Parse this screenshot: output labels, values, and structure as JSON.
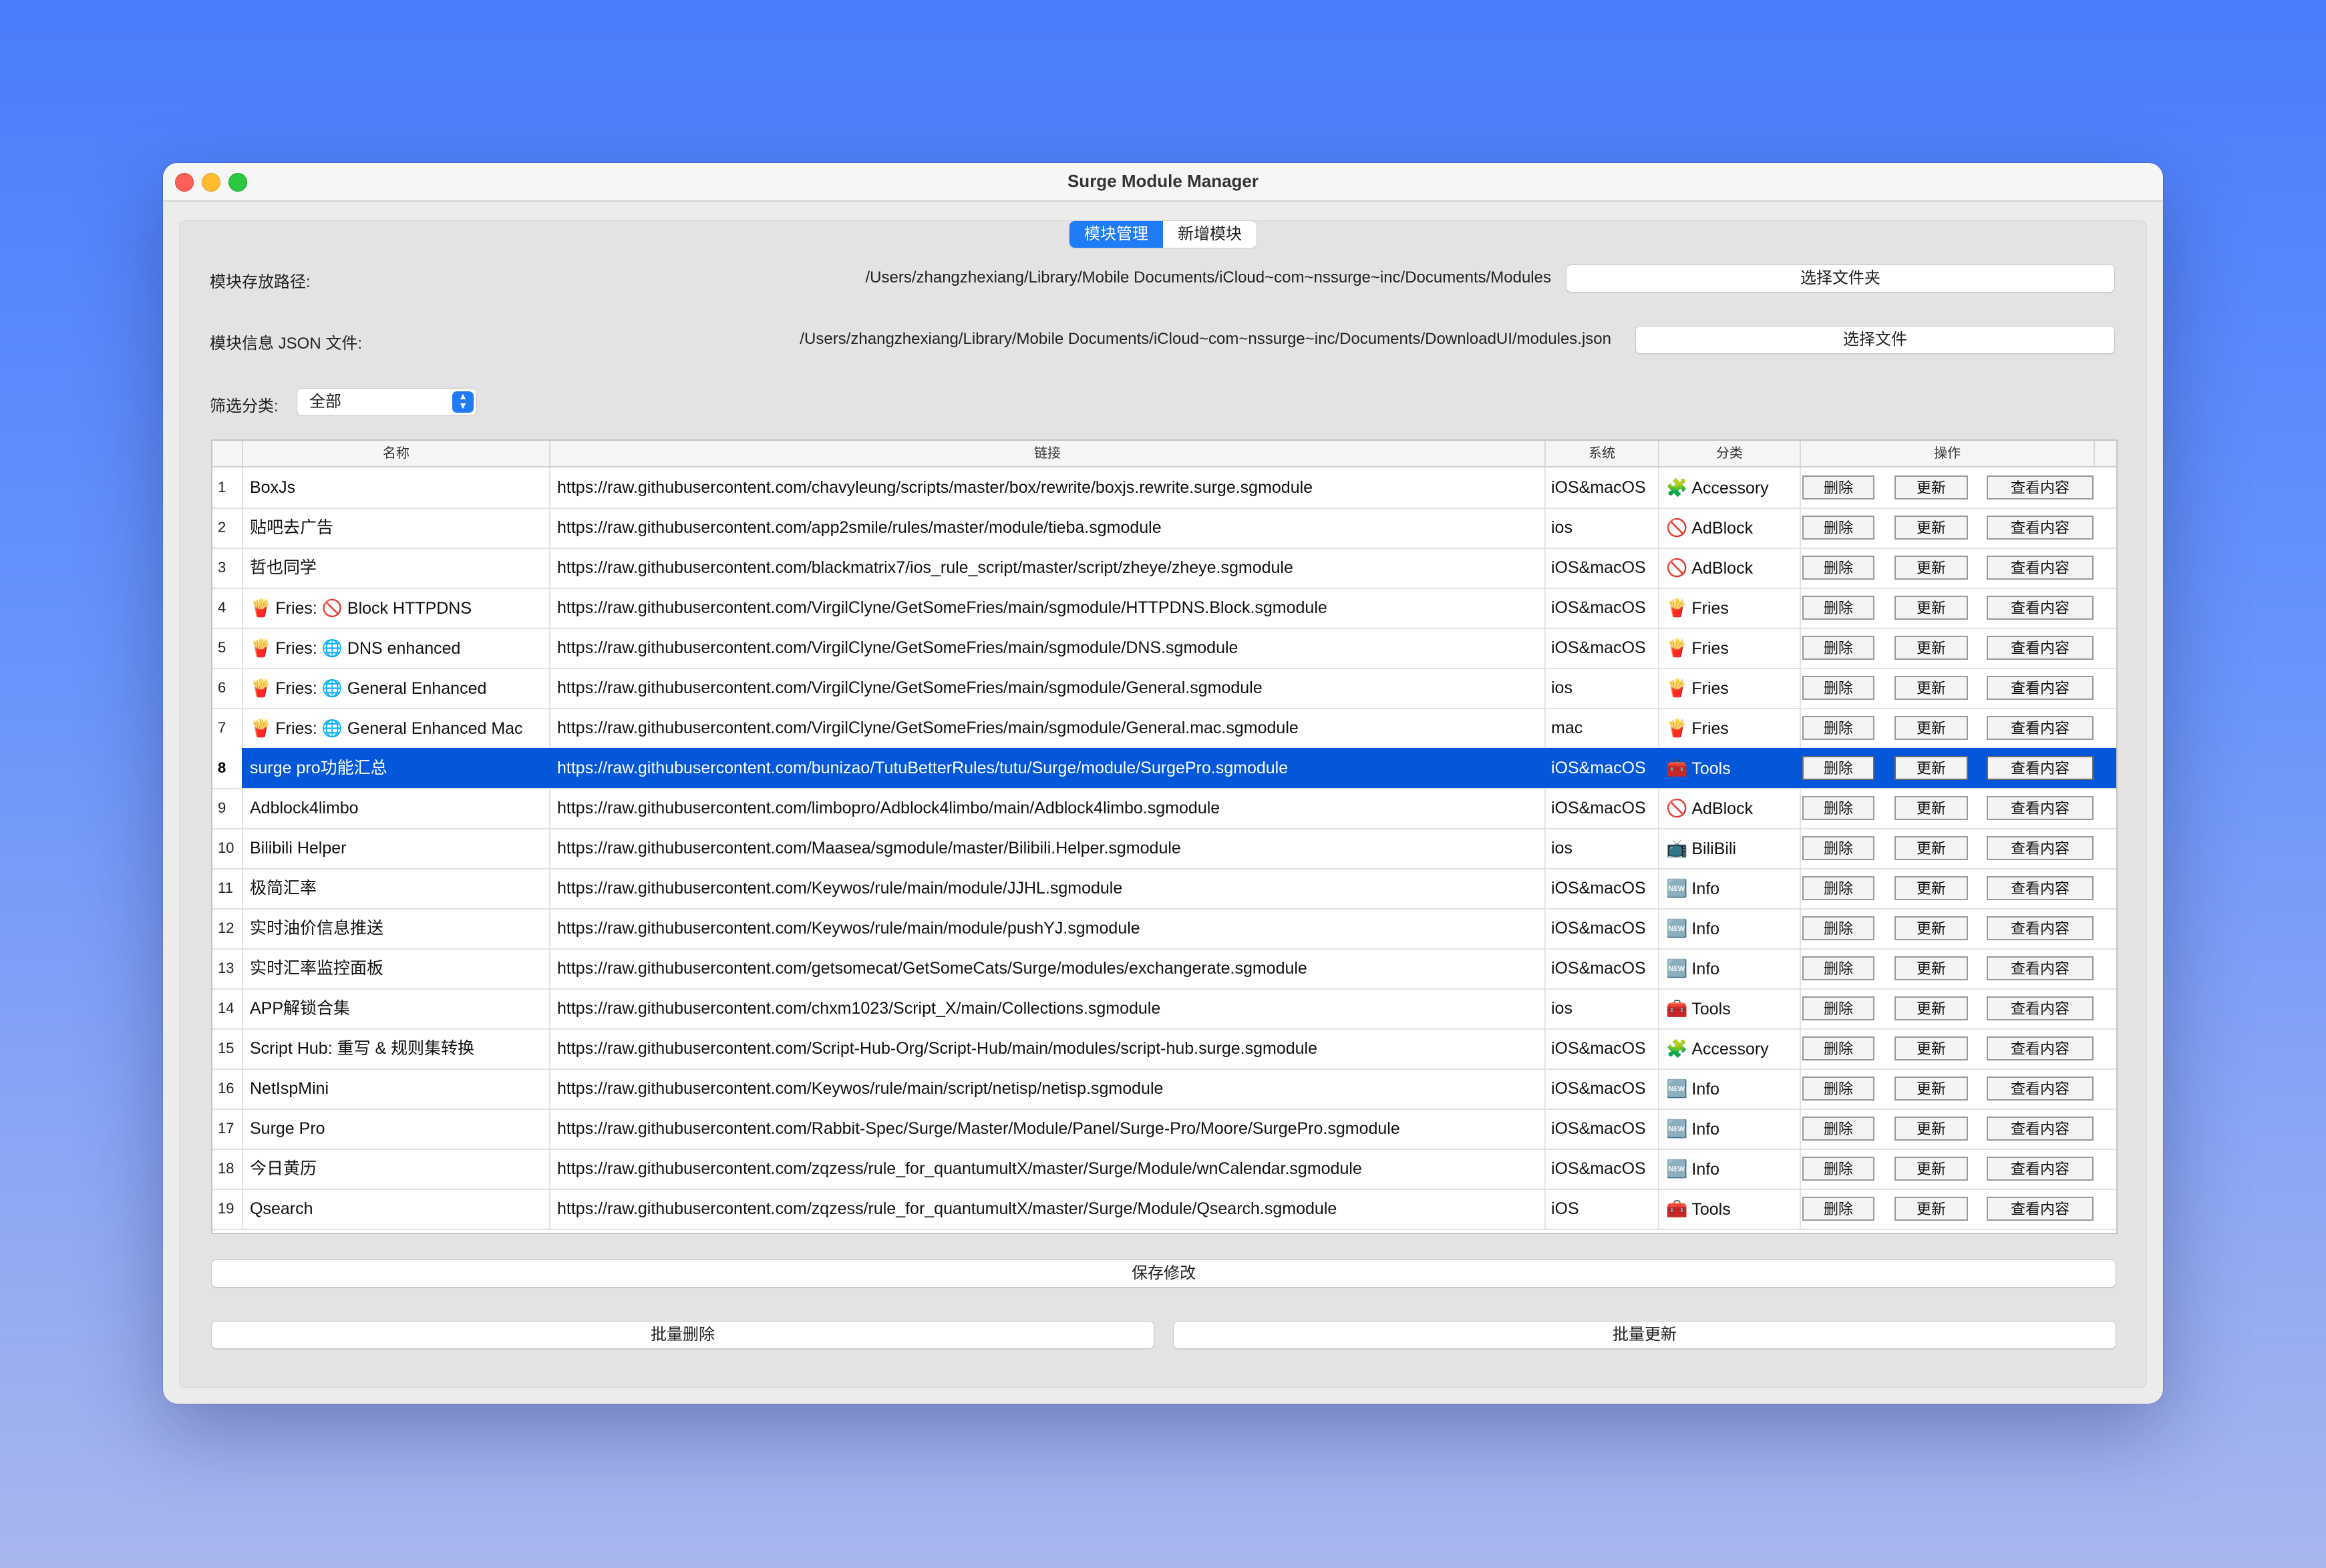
{
  "window": {
    "title": "Surge Module Manager"
  },
  "tabs": [
    {
      "label": "模块管理",
      "active": true
    },
    {
      "label": "新增模块",
      "active": false
    }
  ],
  "module_path": {
    "label": "模块存放路径:",
    "value": "/Users/zhangzhexiang/Library/Mobile Documents/iCloud~com~nssurge~inc/Documents/Modules",
    "button": "选择文件夹"
  },
  "json_file": {
    "label": "模块信息 JSON 文件:",
    "value": "/Users/zhangzhexiang/Library/Mobile Documents/iCloud~com~nssurge~inc/Documents/DownloadUI/modules.json",
    "button": "选择文件"
  },
  "filter": {
    "label": "筛选分类:",
    "selected": "全部"
  },
  "table": {
    "headers": [
      "名称",
      "链接",
      "系统",
      "分类",
      "操作"
    ],
    "action_labels": {
      "delete": "删除",
      "update": "更新",
      "view": "查看内容"
    },
    "selected_row": 8,
    "rows": [
      {
        "idx": "1",
        "name_icon": "",
        "name": "BoxJs",
        "url": "https://raw.githubusercontent.com/chavyleung/scripts/master/box/rewrite/boxjs.rewrite.surge.sgmodule",
        "system": "iOS&macOS",
        "cat_icon": "🧩",
        "category": "Accessory"
      },
      {
        "idx": "2",
        "name_icon": "",
        "name": "贴吧去广告",
        "url": "https://raw.githubusercontent.com/app2smile/rules/master/module/tieba.sgmodule",
        "system": "ios",
        "cat_icon": "🚫",
        "category": "AdBlock"
      },
      {
        "idx": "3",
        "name_icon": "",
        "name": "哲也同学",
        "url": "https://raw.githubusercontent.com/blackmatrix7/ios_rule_script/master/script/zheye/zheye.sgmodule",
        "system": "iOS&macOS",
        "cat_icon": "🚫",
        "category": "AdBlock"
      },
      {
        "idx": "4",
        "name_icon": "🍟",
        "name": "Fries: 🚫 Block HTTPDNS",
        "url": "https://raw.githubusercontent.com/VirgilClyne/GetSomeFries/main/sgmodule/HTTPDNS.Block.sgmodule",
        "system": "iOS&macOS",
        "cat_icon": "🍟",
        "category": "Fries"
      },
      {
        "idx": "5",
        "name_icon": "🍟",
        "name": "Fries: 🌐 DNS enhanced",
        "url": "https://raw.githubusercontent.com/VirgilClyne/GetSomeFries/main/sgmodule/DNS.sgmodule",
        "system": "iOS&macOS",
        "cat_icon": "🍟",
        "category": "Fries"
      },
      {
        "idx": "6",
        "name_icon": "🍟",
        "name": "Fries: 🌐 General Enhanced",
        "url": "https://raw.githubusercontent.com/VirgilClyne/GetSomeFries/main/sgmodule/General.sgmodule",
        "system": "ios",
        "cat_icon": "🍟",
        "category": "Fries"
      },
      {
        "idx": "7",
        "name_icon": "🍟",
        "name": "Fries: 🌐 General Enhanced Mac",
        "url": "https://raw.githubusercontent.com/VirgilClyne/GetSomeFries/main/sgmodule/General.mac.sgmodule",
        "system": "mac",
        "cat_icon": "🍟",
        "category": "Fries"
      },
      {
        "idx": "8",
        "name_icon": "",
        "name": "surge pro功能汇总",
        "url": "https://raw.githubusercontent.com/bunizao/TutuBetterRules/tutu/Surge/module/SurgePro.sgmodule",
        "system": "iOS&macOS",
        "cat_icon": "🧰",
        "category": "Tools"
      },
      {
        "idx": "9",
        "name_icon": "",
        "name": "Adblock4limbo",
        "url": "https://raw.githubusercontent.com/limbopro/Adblock4limbo/main/Adblock4limbo.sgmodule",
        "system": "iOS&macOS",
        "cat_icon": "🚫",
        "category": "AdBlock"
      },
      {
        "idx": "10",
        "name_icon": "",
        "name": "Bilibili Helper",
        "url": "https://raw.githubusercontent.com/Maasea/sgmodule/master/Bilibili.Helper.sgmodule",
        "system": "ios",
        "cat_icon": "📺",
        "category": "BiliBili"
      },
      {
        "idx": "11",
        "name_icon": "",
        "name": "极简汇率",
        "url": "https://raw.githubusercontent.com/Keywos/rule/main/module/JJHL.sgmodule",
        "system": "iOS&macOS",
        "cat_icon": "🆕",
        "category": "Info"
      },
      {
        "idx": "12",
        "name_icon": "",
        "name": "实时油价信息推送",
        "url": "https://raw.githubusercontent.com/Keywos/rule/main/module/pushYJ.sgmodule",
        "system": "iOS&macOS",
        "cat_icon": "🆕",
        "category": "Info"
      },
      {
        "idx": "13",
        "name_icon": "",
        "name": "实时汇率监控面板",
        "url": "https://raw.githubusercontent.com/getsomecat/GetSomeCats/Surge/modules/exchangerate.sgmodule",
        "system": "iOS&macOS",
        "cat_icon": "🆕",
        "category": "Info"
      },
      {
        "idx": "14",
        "name_icon": "",
        "name": "APP解锁合集",
        "url": "https://raw.githubusercontent.com/chxm1023/Script_X/main/Collections.sgmodule",
        "system": "ios",
        "cat_icon": "🧰",
        "category": "Tools"
      },
      {
        "idx": "15",
        "name_icon": "",
        "name": "Script Hub: 重写 & 规则集转换",
        "url": "https://raw.githubusercontent.com/Script-Hub-Org/Script-Hub/main/modules/script-hub.surge.sgmodule",
        "system": "iOS&macOS",
        "cat_icon": "🧩",
        "category": "Accessory"
      },
      {
        "idx": "16",
        "name_icon": "",
        "name": "NetIspMini",
        "url": "https://raw.githubusercontent.com/Keywos/rule/main/script/netisp/netisp.sgmodule",
        "system": "iOS&macOS",
        "cat_icon": "🆕",
        "category": "Info"
      },
      {
        "idx": "17",
        "name_icon": "",
        "name": "Surge Pro",
        "url": "https://raw.githubusercontent.com/Rabbit-Spec/Surge/Master/Module/Panel/Surge-Pro/Moore/SurgePro.sgmodule",
        "system": "iOS&macOS",
        "cat_icon": "🆕",
        "category": "Info"
      },
      {
        "idx": "18",
        "name_icon": "",
        "name": "今日黄历",
        "url": "https://raw.githubusercontent.com/zqzess/rule_for_quantumultX/master/Surge/Module/wnCalendar.sgmodule",
        "system": "iOS&macOS",
        "cat_icon": "🆕",
        "category": "Info"
      },
      {
        "idx": "19",
        "name_icon": "",
        "name": "Qsearch",
        "url": "https://raw.githubusercontent.com/zqzess/rule_for_quantumultX/master/Surge/Module/Qsearch.sgmodule",
        "system": "iOS",
        "cat_icon": "🧰",
        "category": "Tools"
      }
    ]
  },
  "buttons": {
    "save": "保存修改",
    "batch_delete": "批量删除",
    "batch_update": "批量更新"
  }
}
